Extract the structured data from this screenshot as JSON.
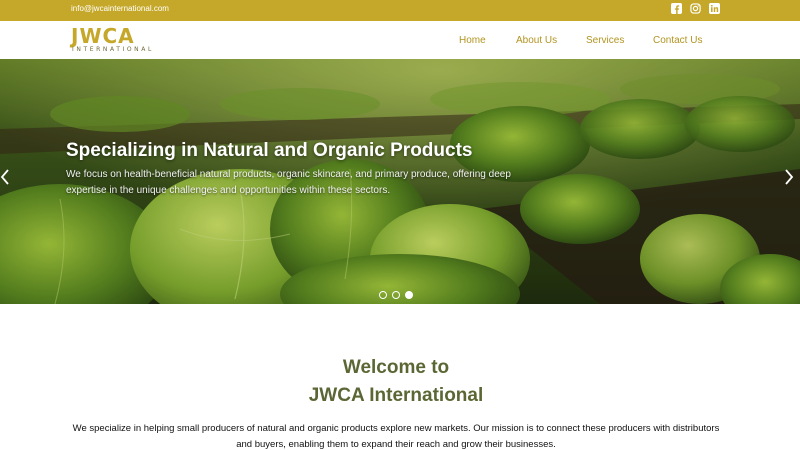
{
  "topbar": {
    "email": "info@jwcainternational.com",
    "social_icons": [
      "facebook-icon",
      "instagram-icon",
      "linkedin-icon"
    ],
    "background": "#c5a829"
  },
  "header": {
    "logo_word": "JWCA",
    "logo_sub": "INTERNATIONAL",
    "nav": {
      "home": "Home",
      "about": "About Us",
      "services": "Services",
      "contact": "Contact Us"
    }
  },
  "hero": {
    "title": "Specializing in Natural and Organic Products",
    "text": "We focus on health-beneficial natural products, organic skincare, and primary produce, offering deep expertise in the unique challenges and opportunities within these sectors.",
    "slides_total": 3,
    "active_slide": 3
  },
  "welcome": {
    "title_line1": "Welcome to",
    "title_line2": "JWCA International",
    "text": "We specialize in helping small producers of natural and organic products explore new markets. Our mission is to connect these producers with distributors and buyers, enabling them to expand their reach and grow their businesses."
  },
  "colors": {
    "brand_gold": "#c5a829",
    "nav_text": "#b39420",
    "heading_green": "#5a6734"
  }
}
